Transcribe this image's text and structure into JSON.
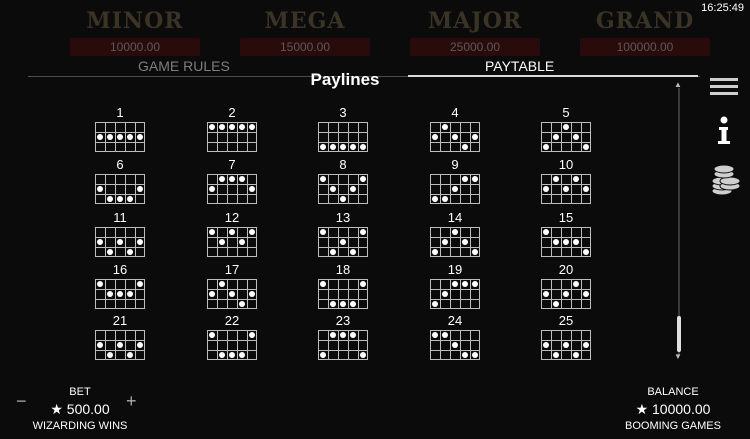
{
  "status": {
    "time": "16:25:49"
  },
  "jackpots": [
    {
      "name": "MINOR",
      "value": "10000.00"
    },
    {
      "name": "MEGA",
      "value": "15000.00"
    },
    {
      "name": "MAJOR",
      "value": "25000.00"
    },
    {
      "name": "GRAND",
      "value": "100000.00"
    }
  ],
  "tabs": {
    "rules_label": "GAME RULES",
    "paytable_label": "PAYTABLE",
    "active": "PAYTABLE"
  },
  "paylines_title": "Paylines",
  "paylines": [
    {
      "n": "1",
      "rows": [
        1,
        1,
        1,
        1,
        1
      ]
    },
    {
      "n": "2",
      "rows": [
        0,
        0,
        0,
        0,
        0
      ]
    },
    {
      "n": "3",
      "rows": [
        2,
        2,
        2,
        2,
        2
      ]
    },
    {
      "n": "4",
      "rows": [
        1,
        0,
        1,
        2,
        1
      ]
    },
    {
      "n": "5",
      "rows": [
        2,
        1,
        0,
        1,
        2
      ]
    },
    {
      "n": "6",
      "rows": [
        1,
        2,
        2,
        2,
        1
      ]
    },
    {
      "n": "7",
      "rows": [
        1,
        0,
        0,
        0,
        1
      ]
    },
    {
      "n": "8",
      "rows": [
        0,
        1,
        2,
        1,
        0
      ]
    },
    {
      "n": "9",
      "rows": [
        2,
        2,
        1,
        0,
        0
      ]
    },
    {
      "n": "10",
      "rows": [
        1,
        0,
        1,
        0,
        1
      ]
    },
    {
      "n": "11",
      "rows": [
        1,
        2,
        1,
        2,
        1
      ]
    },
    {
      "n": "12",
      "rows": [
        0,
        1,
        0,
        1,
        0
      ]
    },
    {
      "n": "13",
      "rows": [
        0,
        2,
        1,
        2,
        0
      ]
    },
    {
      "n": "14",
      "rows": [
        2,
        1,
        0,
        1,
        2
      ]
    },
    {
      "n": "15",
      "rows": [
        0,
        1,
        1,
        1,
        2
      ]
    },
    {
      "n": "16",
      "rows": [
        0,
        1,
        1,
        1,
        0
      ]
    },
    {
      "n": "17",
      "rows": [
        1,
        0,
        1,
        2,
        1
      ]
    },
    {
      "n": "18",
      "rows": [
        0,
        2,
        2,
        2,
        0
      ]
    },
    {
      "n": "19",
      "rows": [
        2,
        1,
        0,
        0,
        0
      ]
    },
    {
      "n": "20",
      "rows": [
        1,
        2,
        1,
        0,
        1
      ]
    },
    {
      "n": "21",
      "rows": [
        1,
        2,
        1,
        2,
        1
      ]
    },
    {
      "n": "22",
      "rows": [
        0,
        2,
        2,
        2,
        0
      ]
    },
    {
      "n": "23",
      "rows": [
        2,
        0,
        0,
        0,
        2
      ]
    },
    {
      "n": "24",
      "rows": [
        0,
        0,
        1,
        2,
        2
      ]
    },
    {
      "n": "25",
      "rows": [
        1,
        2,
        1,
        2,
        1
      ]
    }
  ],
  "side_menu": {
    "icons": [
      "menu-icon",
      "info-icon",
      "coins-icon"
    ]
  },
  "footer": {
    "bet_label": "BET",
    "bet_value": "★ 500.00",
    "game_name": "WIZARDING WINS",
    "minus": "−",
    "plus": "+",
    "balance_label": "BALANCE",
    "balance_value": "★ 10000.00",
    "brand": "BOOMING GAMES"
  }
}
